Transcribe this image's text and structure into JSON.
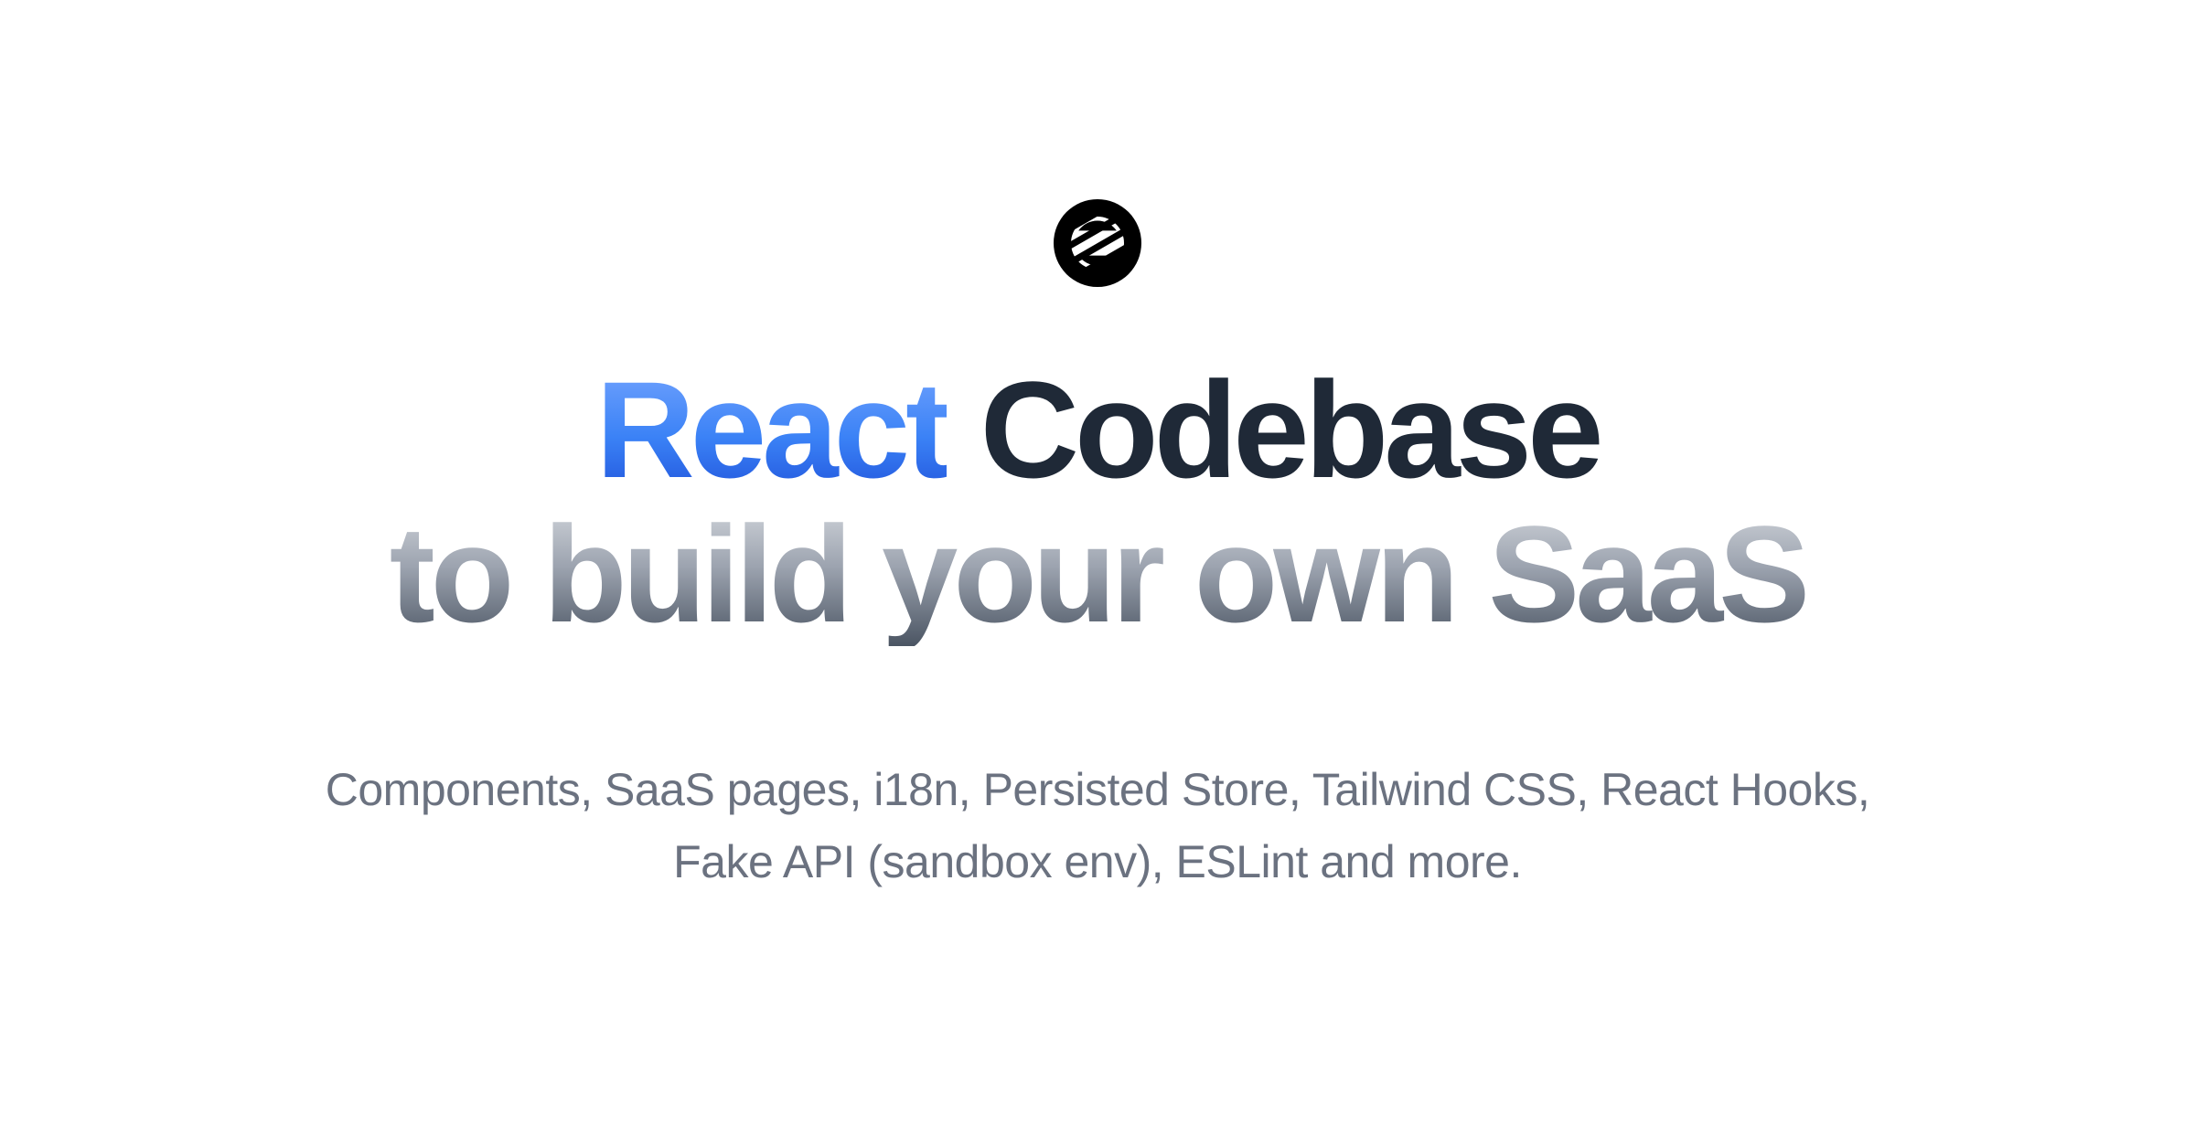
{
  "hero": {
    "headline_react": "React",
    "headline_codebase": " Codebase",
    "headline_line2": "to build your own SaaS",
    "subtitle": "Components, SaaS pages, i18n, Persisted Store, Tailwind CSS, React Hooks, Fake API (sandbox env), ESLint and more."
  }
}
